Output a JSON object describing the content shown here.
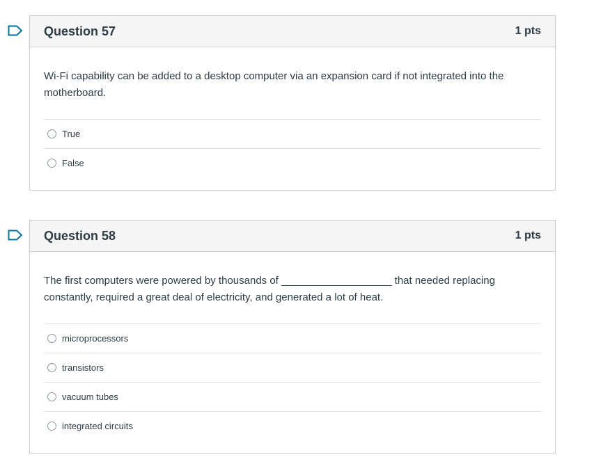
{
  "questions": [
    {
      "title": "Question 57",
      "points": "1 pts",
      "text": "Wi-Fi capability can be added to a desktop computer via an expansion card if not integrated into the motherboard.",
      "answers": [
        "True",
        "False"
      ]
    },
    {
      "title": "Question 58",
      "points": "1 pts",
      "text": "The first computers were powered by thousands of ___________________ that needed replacing constantly, required a great deal of electricity, and generated a lot of heat.",
      "answers": [
        "microprocessors",
        "transistors",
        "vacuum tubes",
        "integrated circuits"
      ]
    }
  ],
  "icons": {
    "flag": "bookmark-flag-icon"
  },
  "colors": {
    "flag": "#0770a3",
    "header_bg": "#f5f5f5",
    "border": "#c7cdd1",
    "text": "#2d3b45"
  }
}
